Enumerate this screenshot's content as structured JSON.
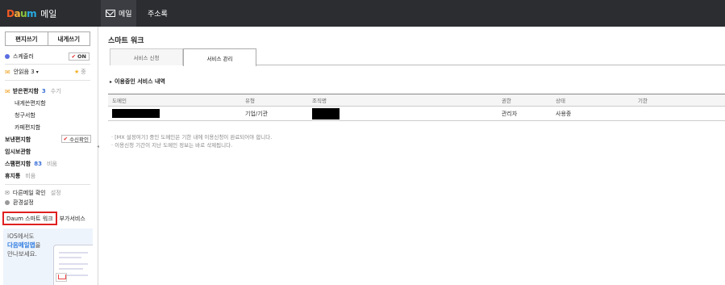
{
  "header": {
    "logo_parts": [
      "D",
      "a",
      "u",
      "m"
    ],
    "app_title": "메일",
    "tabs": [
      {
        "label": "메일"
      },
      {
        "label": "주소록"
      }
    ]
  },
  "sidebar": {
    "compose_label": "편지쓰기",
    "self_label": "내게쓰기",
    "scheduler_label": "스케줄러",
    "scheduler_badge": "ON",
    "mail_user_label": "안읽음 3",
    "star_label": "중",
    "inbox_label": "받은편지함",
    "inbox_count": "3",
    "inbox_extra": "수기",
    "folders": [
      {
        "label": "내게쓴편지함"
      },
      {
        "label": "청구서함"
      },
      {
        "label": "카페편지함"
      }
    ],
    "sent_label": "보낸편지함",
    "sent_badge": "수신확인",
    "temp_label": "임시보관함",
    "spam_label": "스팸편지함",
    "spam_count": "83",
    "spam_extra": "비움",
    "trash_label": "휴지통",
    "trash_extra": "비움",
    "other_mail_label": "다른메일 확인",
    "other_mail_extra": "설정",
    "settings_label": "환경설정",
    "smart_work_label": "Daum 스마트 워크",
    "addon_label": "부가서비스",
    "promo_line1": "iOS에서도",
    "promo_line2": "다음메일앱",
    "promo_line2_suffix": "을",
    "promo_line3": "만나보세요."
  },
  "main": {
    "page_title": "스마트 워크",
    "tabs": [
      {
        "label": "서비스 신청"
      },
      {
        "label": "서비스 관리"
      }
    ],
    "section_title": "이용중인 서비스 내역",
    "table": {
      "columns": [
        "도메인",
        "유형",
        "조직명",
        "권한",
        "상태",
        "기한"
      ],
      "rows": [
        {
          "domain": "",
          "type": "기업/기관",
          "org": "",
          "role": "관리자",
          "status": "사용중",
          "expiry": ""
        }
      ]
    },
    "notes": [
      "· [MX 설정여기] 중인 도메인은 기한 내에 이용신청이 완료되어야 합니다.",
      "· 이용신청 기간이 지난 도메인 정보는 바로 삭제됩니다."
    ]
  },
  "colors": {
    "topbar": "#2b2d31",
    "accent_blue": "#3a6fd8",
    "highlight_red": "#e02020"
  }
}
